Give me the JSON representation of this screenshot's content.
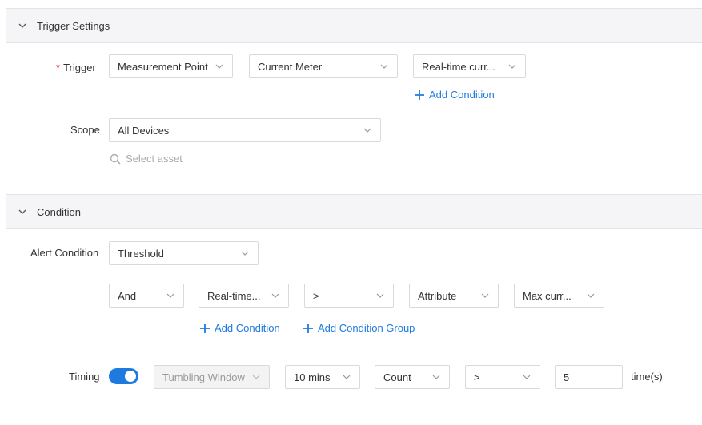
{
  "trigger_section": {
    "title": "Trigger Settings",
    "trigger_label": "Trigger",
    "trigger_required_mark": "*",
    "trigger_selects": [
      "Measurement Point",
      "Current Meter",
      "Real-time curr..."
    ],
    "add_condition": "Add Condition",
    "scope_label": "Scope",
    "scope_value": "All Devices",
    "select_asset_placeholder": "Select asset"
  },
  "condition_section": {
    "title": "Condition",
    "alert_condition_label": "Alert Condition",
    "alert_condition_value": "Threshold",
    "row_selects": [
      "And",
      "Real-time...",
      ">",
      "Attribute",
      "Max curr..."
    ],
    "add_condition": "Add Condition",
    "add_condition_group": "Add Condition Group",
    "timing_label": "Timing",
    "timing_enabled": true,
    "window_type": "Tumbling Window",
    "window_size": "10 mins",
    "aggregate": "Count",
    "operator": ">",
    "count_value": "5",
    "count_unit": "time(s)"
  },
  "colors": {
    "accent": "#1f7ae0",
    "required": "#e64545",
    "header_bg": "#f5f5f7"
  }
}
